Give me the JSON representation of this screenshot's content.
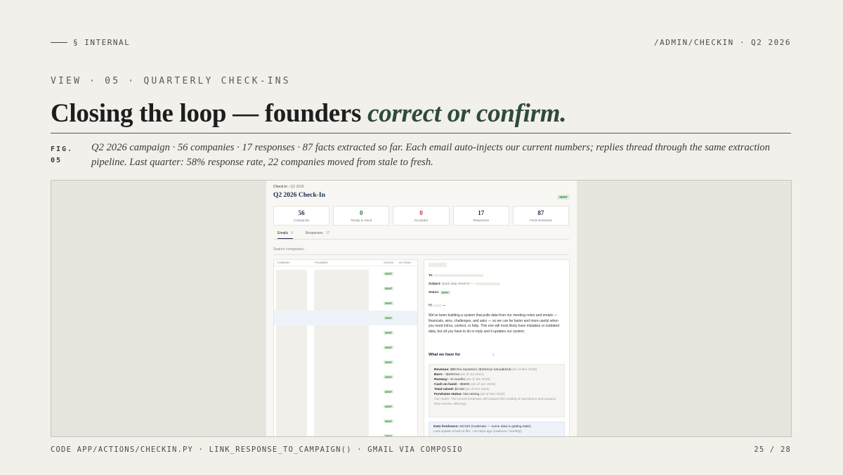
{
  "header": {
    "section": "§ INTERNAL",
    "route": "/ADMIN/CHECKIN · Q2 2026"
  },
  "view_label": "VIEW · 05 · QUARTERLY CHECK-INS",
  "title": {
    "main": "Closing the loop — founders ",
    "emphasis": "correct or confirm."
  },
  "figure": {
    "label_line1": "FIG.",
    "label_line2": "05",
    "caption": "Q2 2026 campaign · 56 companies · 17 responses · 87 facts extracted so far. Each email auto-injects our current numbers; replies thread through the same extraction pipeline. Last quarter: 58% response rate, 22 companies moved from stale to fresh."
  },
  "screenshot": {
    "breadcrumb_root": "Check-In",
    "breadcrumb_leaf": "Q2 2026",
    "page_title": "Q2 2026 Check-In",
    "status_badge": "SENT",
    "stats": [
      {
        "value": "56",
        "label": "Companies",
        "color": "#1d2b4a"
      },
      {
        "value": "0",
        "label": "Ready to Send",
        "color": "#2e7d32"
      },
      {
        "value": "0",
        "label": "Excluded",
        "color": "#c0392b"
      },
      {
        "value": "17",
        "label": "Responses",
        "color": "#1d2b4a"
      },
      {
        "value": "87",
        "label": "Facts Extracted",
        "color": "#1d2b4a"
      }
    ],
    "tabs": [
      {
        "label": "Emails",
        "count": "0"
      },
      {
        "label": "Responses",
        "count": "17"
      }
    ],
    "search_placeholder": "Search companies...",
    "table_columns": [
      "COMPANY",
      "FOUNDER",
      "STATUS",
      "ACTIONS"
    ],
    "row_status": "SENT",
    "detail": {
      "to_label": "To:",
      "subject_label": "Subject:",
      "subject_value": "Quick data check-in —",
      "status_label": "Status:",
      "status_value": "SENT",
      "greeting": "Hi",
      "greeting_dash": "—",
      "body": "We've been building a system that pulls data from our meeting notes and emails — financials, wins, challenges, and asks — so we can be faster and more useful when you need intros, context, or help. This one will most likely have mistakes or outdated data, but all you have to do is reply and it updates our system.",
      "section_title": "What we have for",
      "section_colon": ":",
      "facts": [
        {
          "label": "Revenue:",
          "value": "$8K/mo reported (~$101K/yr annualized)",
          "asof": "(as of Mar 2026)"
        },
        {
          "label": "Burn:",
          "value": "~$42K/mo",
          "asof": "(as of Jul 2024)"
        },
        {
          "label": "Runway:",
          "value": "~8 months",
          "asof": "(as of Jan 2025)"
        },
        {
          "label": "Cash on hand:",
          "value": "~$680K",
          "asof": "(as of Jan 2025)"
        },
        {
          "label": "Total raised:",
          "value": "$2.5M",
          "asof": "(as of Oct 2025)"
        },
        {
          "label": "Fundraise status:",
          "value": "Not raising",
          "asof": "(as of Mar 2026)"
        }
      ],
      "notes": "Our notes: The recent fundraise will support the scaling of        operations and expand their service offerings.",
      "freshness_label": "Data freshness:",
      "freshness_value": "64/100 (moderate — some data is getting stale)",
      "last_update": "Last update email on file: ~43 days ago (cadence: monthly)"
    }
  },
  "footer": {
    "code": "CODE APP/ACTIONS/CHECKIN.PY · LINK_RESPONSE_TO_CAMPAIGN() · GMAIL VIA COMPOSIO",
    "page": "25 / 28"
  }
}
